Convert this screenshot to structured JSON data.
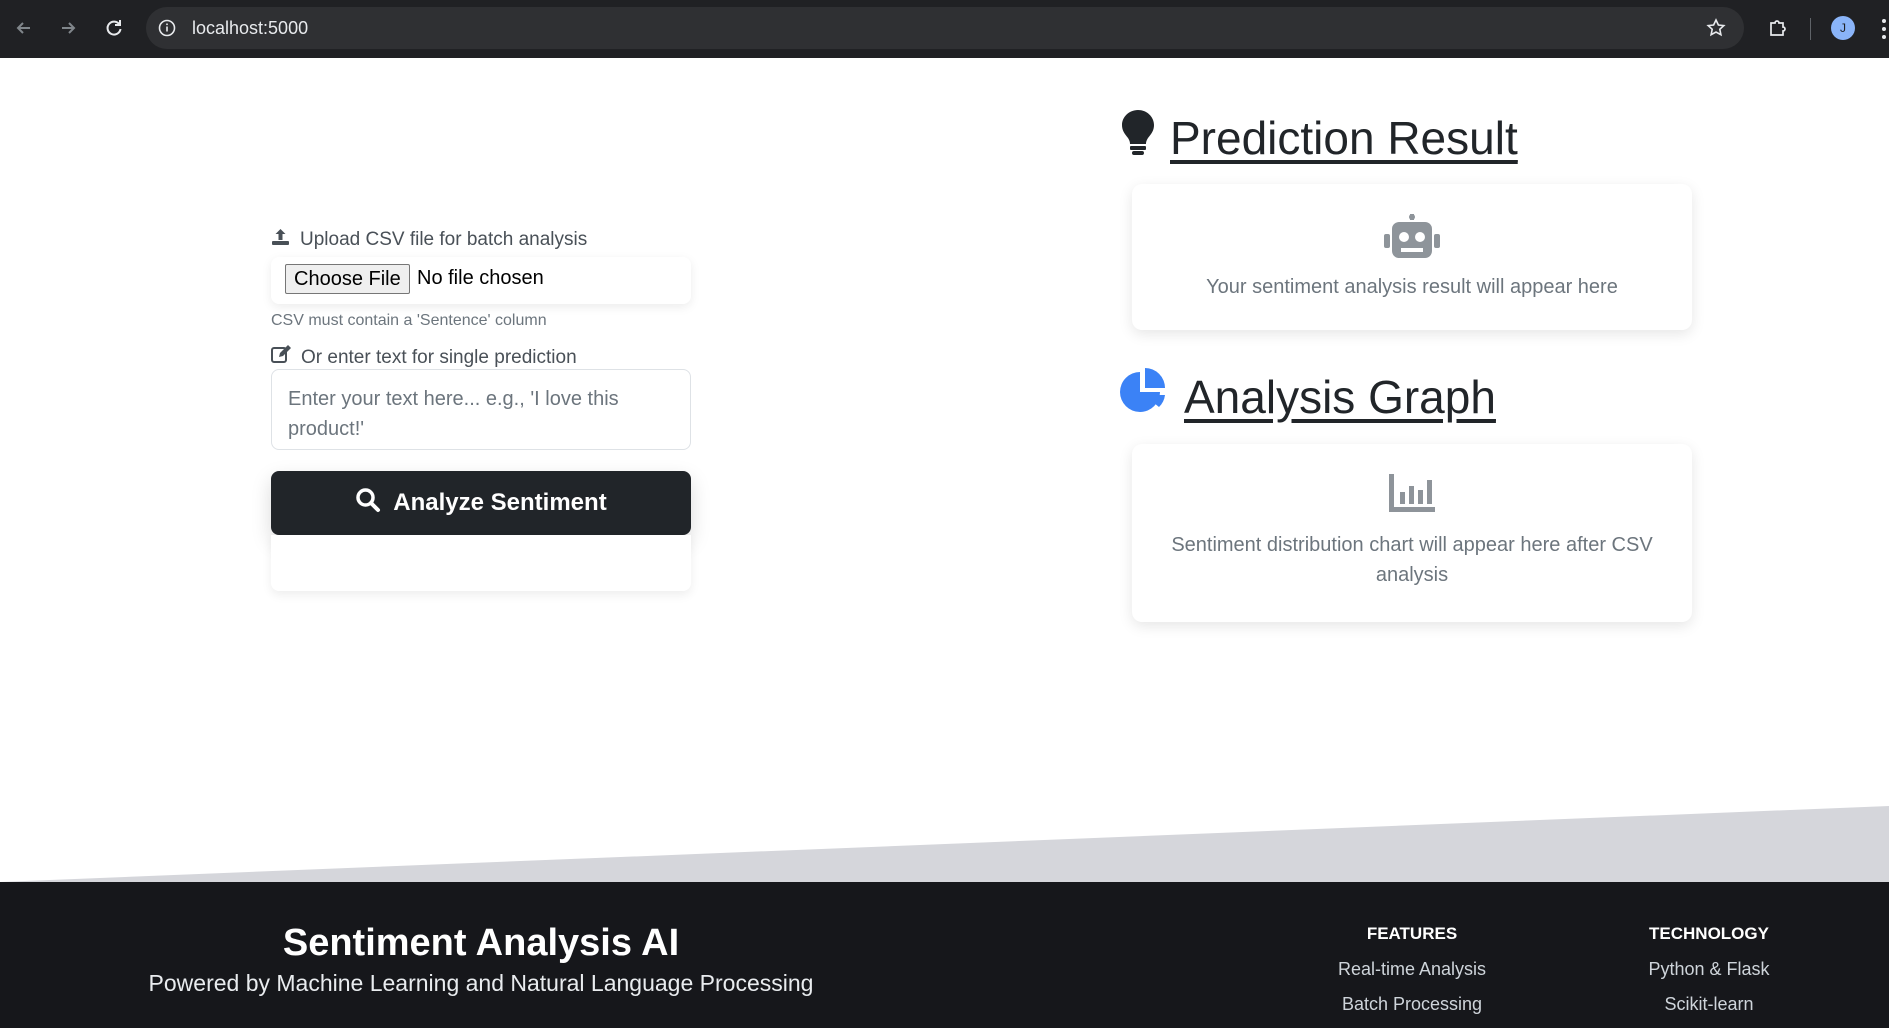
{
  "browser": {
    "url": "localhost:5000",
    "profile_initial": "J"
  },
  "form": {
    "upload_label": "Upload CSV file for batch analysis",
    "choose_file_label": "Choose File",
    "file_status": "No file chosen",
    "csv_hint": "CSV must contain a 'Sentence' column",
    "text_label": "Or enter text for single prediction",
    "text_placeholder": "Enter your text here... e.g., 'I love this product!'",
    "analyze_label": "Analyze Sentiment"
  },
  "prediction": {
    "title": "Prediction Result",
    "message": "Your sentiment analysis result will appear here"
  },
  "graph": {
    "title": "Analysis Graph",
    "message": "Sentiment distribution chart will appear here after CSV analysis"
  },
  "footer": {
    "brand": "Sentiment Analysis AI",
    "tagline": "Powered by Machine Learning and Natural Language Processing",
    "columns": [
      {
        "heading": "FEATURES",
        "links": [
          "Real-time Analysis",
          "Batch Processing"
        ]
      },
      {
        "heading": "TECHNOLOGY",
        "links": [
          "Python & Flask",
          "Scikit-learn"
        ]
      }
    ]
  },
  "colors": {
    "accent_blue": "#3b82f6",
    "dark": "#212529",
    "footer_bg": "#16171b",
    "slant_gray": "#d5d6db"
  }
}
